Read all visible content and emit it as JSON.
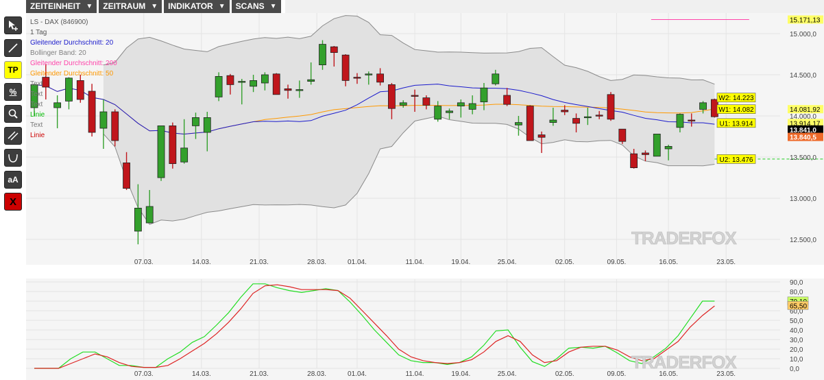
{
  "menu": {
    "zeiteinheit": "ZEITEINHEIT",
    "zeitraum": "ZEITRAUM",
    "indikator": "INDIKATOR",
    "scans": "SCANS"
  },
  "toolbar": {
    "tp_label": "TP",
    "percent_label": "%",
    "text_label": "aA",
    "delete_label": "X"
  },
  "legend": {
    "instrument": "LS - DAX (846900)",
    "timeframe": "1 Tag",
    "items": [
      {
        "label": "Gleitender Durchschnitt: 20",
        "color": "#1a1acc"
      },
      {
        "label": "Bollinger Band: 20",
        "color": "#808080"
      },
      {
        "label": "Gleitender Durchschnitt: 200",
        "color": "#ff44aa"
      },
      {
        "label": "Gleitender Durchschnitt: 50",
        "color": "#ff9900"
      },
      {
        "label": "Text",
        "color": "#777777"
      },
      {
        "label": "Text",
        "color": "#777777"
      },
      {
        "label": "Text",
        "color": "#777777"
      },
      {
        "label": "Linie",
        "color": "#00bb00"
      },
      {
        "label": "Text",
        "color": "#777777"
      },
      {
        "label": "Linie",
        "color": "#cc0000"
      }
    ]
  },
  "watermark": "TRADERFOX",
  "chart_data": [
    {
      "type": "candlestick",
      "y_range": [
        12250,
        15250
      ],
      "y_ticks": [
        "15.000,0",
        "14.500,0",
        "14.000,0",
        "13.500,0",
        "13.000,0",
        "12.500,0"
      ],
      "y_tick_values": [
        15000,
        14500,
        14000,
        13500,
        13000,
        12500
      ],
      "x_tick_labels": [
        "07.03.",
        "14.03.",
        "21.03.",
        "28.03.",
        "01.04.",
        "11.04.",
        "19.04.",
        "25.04.",
        "02.05.",
        "09.05.",
        "16.05.",
        "23.05."
      ],
      "x_tick_index": [
        9.5,
        14.5,
        19.5,
        24.5,
        28,
        33,
        37,
        41,
        46,
        50.5,
        55,
        60
      ],
      "n_slots": 63,
      "colors": {
        "up": "#33a02c",
        "down": "#c0161c"
      },
      "candles": [
        {
          "o": 14100,
          "h": 14390,
          "l": 14000,
          "c": 14380
        },
        {
          "o": 14470,
          "h": 14630,
          "l": 14200,
          "c": 14350
        },
        {
          "o": 14100,
          "h": 14250,
          "l": 13850,
          "c": 14160
        },
        {
          "o": 14180,
          "h": 14470,
          "l": 14080,
          "c": 14460
        },
        {
          "o": 14430,
          "h": 14500,
          "l": 14160,
          "c": 14200
        },
        {
          "o": 14300,
          "h": 14390,
          "l": 13750,
          "c": 13800
        },
        {
          "o": 13850,
          "h": 14200,
          "l": 13600,
          "c": 14050
        },
        {
          "o": 14050,
          "h": 14080,
          "l": 13630,
          "c": 13700
        },
        {
          "o": 13430,
          "h": 13560,
          "l": 13100,
          "c": 13120
        },
        {
          "o": 12600,
          "h": 13170,
          "l": 12440,
          "c": 12880
        },
        {
          "o": 12700,
          "h": 13100,
          "l": 12700,
          "c": 12900
        },
        {
          "o": 13250,
          "h": 13880,
          "l": 13210,
          "c": 13880
        },
        {
          "o": 13880,
          "h": 13920,
          "l": 13360,
          "c": 13420
        },
        {
          "o": 13440,
          "h": 13960,
          "l": 13420,
          "c": 13610
        },
        {
          "o": 13880,
          "h": 14040,
          "l": 13720,
          "c": 13980
        },
        {
          "o": 13800,
          "h": 14050,
          "l": 13570,
          "c": 13980
        },
        {
          "o": 14230,
          "h": 14530,
          "l": 14180,
          "c": 14480
        },
        {
          "o": 14490,
          "h": 14510,
          "l": 14260,
          "c": 14380
        },
        {
          "o": 14420,
          "h": 14450,
          "l": 14140,
          "c": 14420
        },
        {
          "o": 14360,
          "h": 14500,
          "l": 14290,
          "c": 14430
        },
        {
          "o": 14400,
          "h": 14530,
          "l": 14310,
          "c": 14500
        },
        {
          "o": 14510,
          "h": 14520,
          "l": 14260,
          "c": 14260
        },
        {
          "o": 14330,
          "h": 14380,
          "l": 14210,
          "c": 14310
        },
        {
          "o": 14320,
          "h": 14430,
          "l": 14220,
          "c": 14320
        },
        {
          "o": 14420,
          "h": 14650,
          "l": 14380,
          "c": 14440
        },
        {
          "o": 14620,
          "h": 14920,
          "l": 14560,
          "c": 14870
        },
        {
          "o": 14840,
          "h": 14850,
          "l": 14600,
          "c": 14770
        },
        {
          "o": 14740,
          "h": 14750,
          "l": 14360,
          "c": 14430
        },
        {
          "o": 14470,
          "h": 14520,
          "l": 14390,
          "c": 14460
        },
        {
          "o": 14510,
          "h": 14540,
          "l": 14380,
          "c": 14510
        },
        {
          "o": 14510,
          "h": 14580,
          "l": 14370,
          "c": 14410
        },
        {
          "o": 14380,
          "h": 14400,
          "l": 13960,
          "c": 14090
        },
        {
          "o": 14130,
          "h": 14190,
          "l": 14100,
          "c": 14160
        },
        {
          "o": 14250,
          "h": 14320,
          "l": 14050,
          "c": 14240
        },
        {
          "o": 14220,
          "h": 14250,
          "l": 14080,
          "c": 14130
        },
        {
          "o": 13960,
          "h": 14180,
          "l": 13930,
          "c": 14120
        },
        {
          "o": 14040,
          "h": 14090,
          "l": 13960,
          "c": 14060
        },
        {
          "o": 14120,
          "h": 14200,
          "l": 13980,
          "c": 14160
        },
        {
          "o": 14080,
          "h": 14250,
          "l": 14020,
          "c": 14150
        },
        {
          "o": 14170,
          "h": 14400,
          "l": 14070,
          "c": 14340
        },
        {
          "o": 14390,
          "h": 14560,
          "l": 14370,
          "c": 14510
        },
        {
          "o": 14250,
          "h": 14340,
          "l": 14120,
          "c": 14140
        },
        {
          "o": 13890,
          "h": 14000,
          "l": 13760,
          "c": 13920
        },
        {
          "o": 14120,
          "h": 14130,
          "l": 13720,
          "c": 13700
        },
        {
          "o": 13770,
          "h": 13810,
          "l": 13550,
          "c": 13740
        },
        {
          "o": 13920,
          "h": 14100,
          "l": 13880,
          "c": 13950
        },
        {
          "o": 14070,
          "h": 14130,
          "l": 14010,
          "c": 14050
        },
        {
          "o": 13970,
          "h": 14030,
          "l": 13800,
          "c": 13910
        },
        {
          "o": 13980,
          "h": 14100,
          "l": 13890,
          "c": 13990
        },
        {
          "o": 14010,
          "h": 14060,
          "l": 13960,
          "c": 14000
        },
        {
          "o": 14260,
          "h": 14290,
          "l": 13940,
          "c": 13960
        },
        {
          "o": 13840,
          "h": 13840,
          "l": 13660,
          "c": 13690
        },
        {
          "o": 13540,
          "h": 13600,
          "l": 13360,
          "c": 13370
        },
        {
          "o": 13550,
          "h": 13580,
          "l": 13450,
          "c": 13530
        },
        {
          "o": 13510,
          "h": 13650,
          "l": 13510,
          "c": 13780
        },
        {
          "o": 13600,
          "h": 13650,
          "l": 13460,
          "c": 13630
        },
        {
          "o": 13860,
          "h": 14030,
          "l": 13800,
          "c": 14020
        },
        {
          "o": 13950,
          "h": 14030,
          "l": 13870,
          "c": 13940
        },
        {
          "o": 14080,
          "h": 14180,
          "l": 14030,
          "c": 14160
        },
        {
          "o": 14200,
          "h": 14210,
          "l": 13980,
          "c": 13990
        }
      ],
      "ma200": {
        "color": "#ff44aa",
        "points": [
          [
            53.5,
            15171
          ],
          [
            62,
            15171
          ]
        ]
      },
      "levels": [
        {
          "label": "W2: 14.223",
          "value": 14223,
          "start": 62
        },
        {
          "label": "W1: 14.082",
          "value": 14082,
          "start": 62
        },
        {
          "label": "U1: 13.914",
          "value": 13914,
          "start": 62
        },
        {
          "label": "U2: 13.476",
          "value": 13476,
          "start": 59
        }
      ],
      "price_tags": [
        {
          "text": "15.171,13",
          "value": 15171,
          "bg": "#ffff66",
          "fg": "#000000"
        },
        {
          "text": "14.081,92",
          "value": 14082,
          "bg": "#ffff66",
          "fg": "#000000"
        },
        {
          "text": "13.914,17",
          "value": 13914,
          "bg": "#ffff66",
          "fg": "#000000"
        },
        {
          "text": "13.841,0",
          "value": 13835,
          "bg": "#000000",
          "fg": "#ffffff"
        },
        {
          "text": "13.840,5",
          "value": 13745,
          "bg": "#ee6a2a",
          "fg": "#ffffff"
        }
      ]
    },
    {
      "type": "line",
      "y_range": [
        0,
        90
      ],
      "y_ticks": [
        "90,0",
        "80,0",
        "70,0",
        "60,0",
        "50,0",
        "40,0",
        "30,0",
        "20,0",
        "10,0",
        "0,0"
      ],
      "y_tick_values": [
        90,
        80,
        70,
        60,
        50,
        40,
        30,
        20,
        10,
        0
      ],
      "x_tick_labels": [
        "07.03.",
        "14.03.",
        "21.03.",
        "28.03.",
        "01.04.",
        "11.04.",
        "19.04.",
        "25.04.",
        "02.05.",
        "09.05.",
        "16.05.",
        "23.05."
      ],
      "series": [
        {
          "color": "#22dd22",
          "values": [
            0,
            0,
            0,
            10,
            17,
            17,
            10,
            3,
            3,
            1,
            1,
            10,
            17,
            27,
            33,
            45,
            58,
            74,
            88,
            88,
            84,
            81,
            79,
            81,
            83,
            81,
            69,
            55,
            40,
            27,
            14,
            8,
            6,
            6,
            4,
            6,
            12,
            24,
            39,
            40,
            22,
            7,
            2,
            10,
            21,
            22,
            21,
            23,
            16,
            8,
            5,
            12,
            21,
            34,
            52,
            70,
            70
          ]
        },
        {
          "color": "#dd2222",
          "values": [
            0,
            0,
            0,
            5,
            10,
            15,
            12,
            6,
            2,
            1,
            1,
            3,
            10,
            18,
            26,
            36,
            48,
            62,
            78,
            86,
            87,
            85,
            82,
            82,
            82,
            81,
            73,
            60,
            47,
            34,
            20,
            12,
            8,
            6,
            5,
            6,
            9,
            17,
            28,
            34,
            28,
            14,
            6,
            8,
            17,
            22,
            23,
            23,
            19,
            12,
            8,
            10,
            19,
            28,
            43,
            55,
            65
          ]
        }
      ],
      "value_tags": [
        {
          "text": "70,10",
          "value": 70.1,
          "bg": "#ccff66",
          "fg": "#000000"
        },
        {
          "text": "65,50",
          "value": 65.5,
          "bg": "#ffcc66",
          "fg": "#000000"
        }
      ]
    }
  ]
}
